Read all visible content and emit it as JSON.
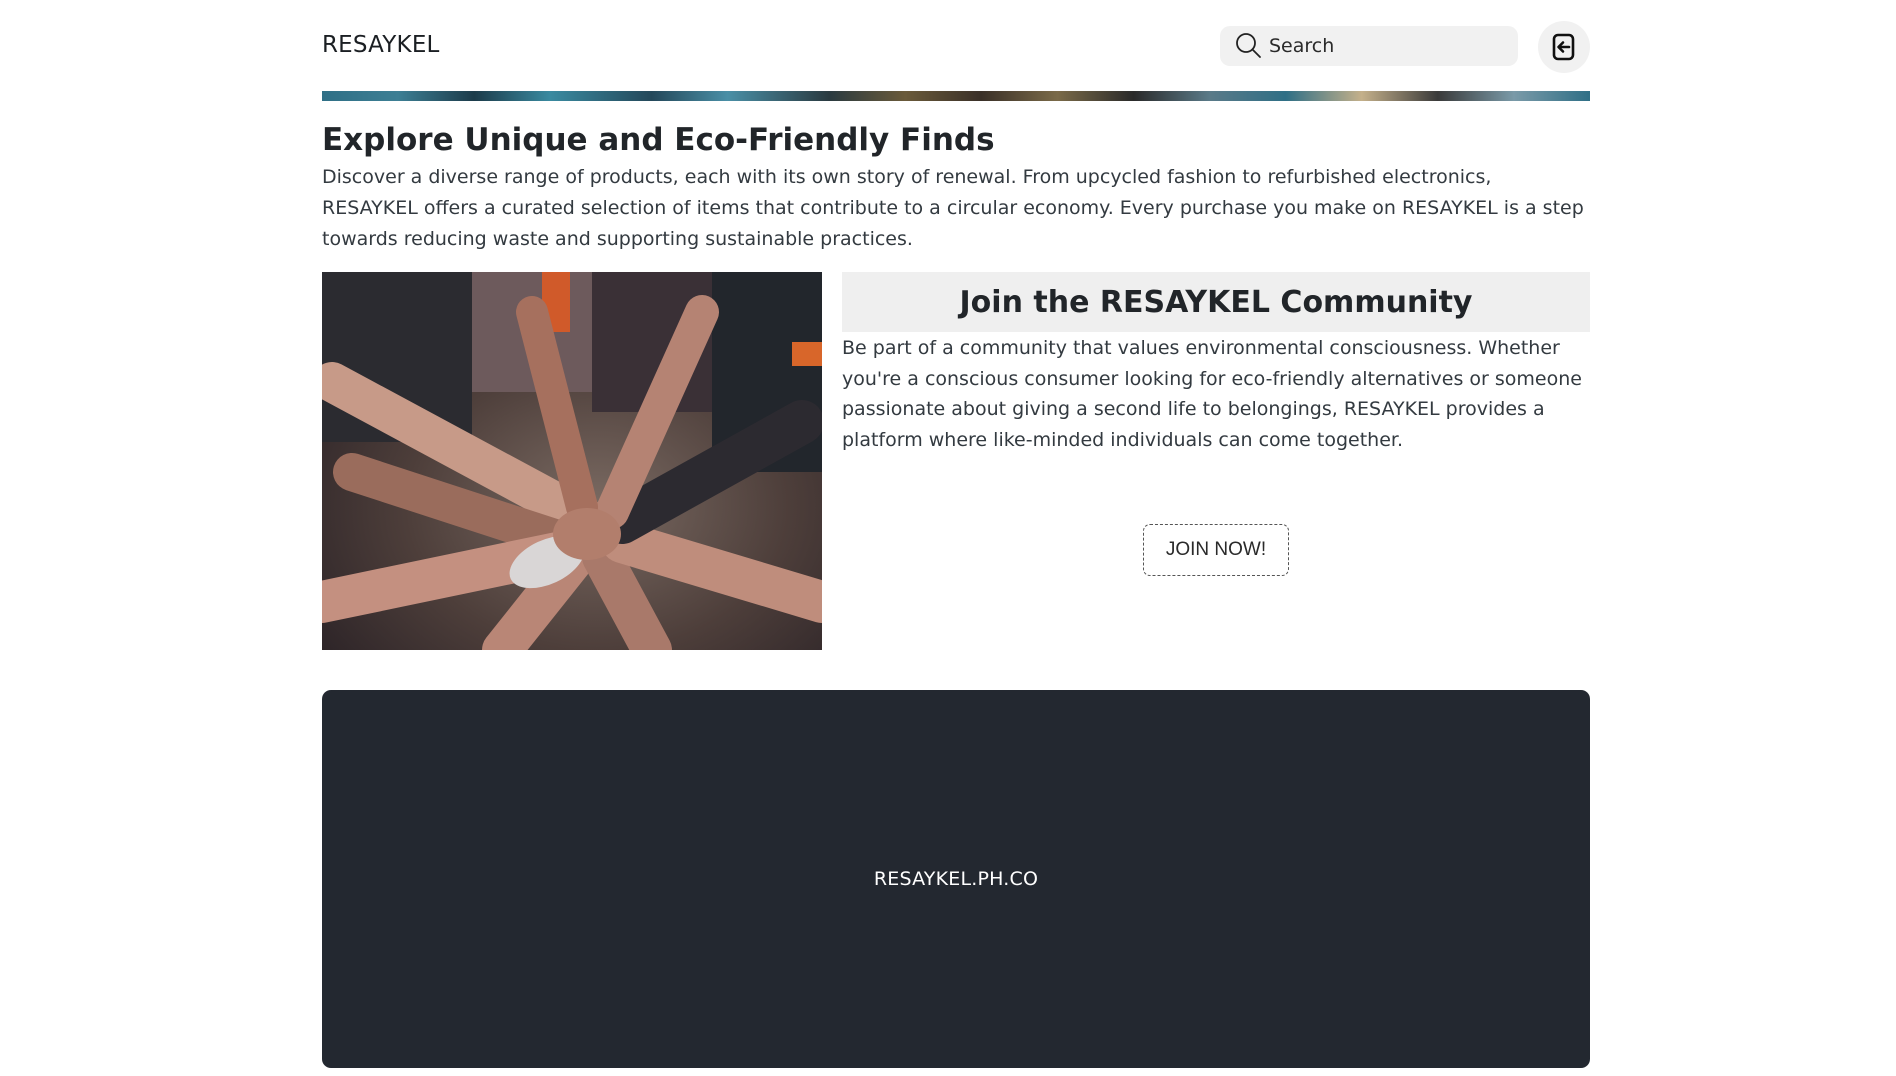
{
  "header": {
    "brand": "RESAYKEL",
    "search_placeholder": "Search",
    "search_icon": "search-icon",
    "logout_icon": "logout-icon"
  },
  "explore": {
    "title": "Explore Unique and Eco-Friendly Finds",
    "text": "Discover a diverse range of products, each with its own story of renewal. From upcycled fashion to refurbished electronics, RESAYKEL offers a curated selection of items that contribute to a circular economy. Every purchase you make on RESAYKEL is a step towards reducing waste and supporting sustainable practices."
  },
  "community": {
    "heading": "Join the RESAYKEL Community",
    "text": "Be part of a community that values environmental consciousness. Whether you're a conscious consumer looking for eco-friendly alternatives or someone passionate about giving a second life to belongings, RESAYKEL provides a platform where like-minded individuals can come together.",
    "button_label": "JOIN NOW!"
  },
  "footer": {
    "text": "RESAYKEL.PH.CO"
  },
  "colors": {
    "footer_bg": "#232830",
    "heading_box_bg": "#efefef",
    "search_bg": "#f1f1f1"
  }
}
